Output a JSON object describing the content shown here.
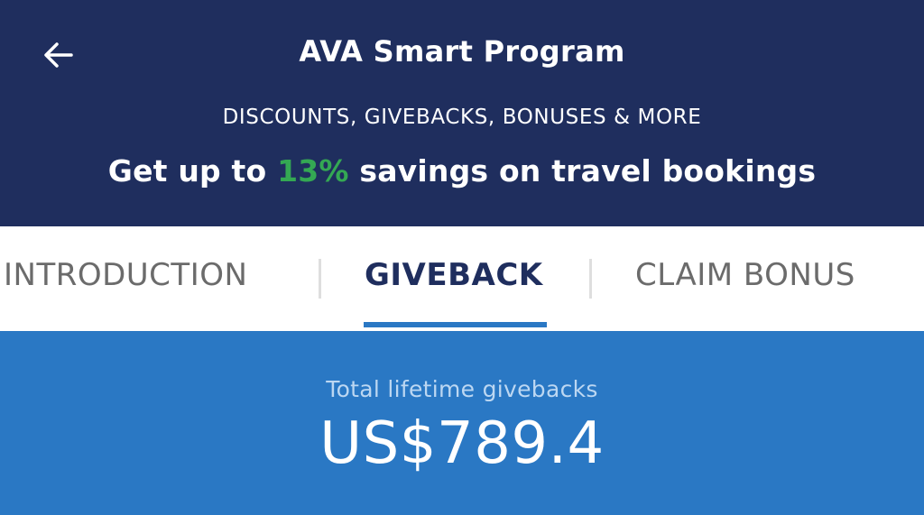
{
  "header": {
    "back_icon": "arrow-left-icon",
    "title": "AVA Smart Program",
    "subtitle": "DISCOUNTS, GIVEBACKS, BONUSES & MORE",
    "promo": {
      "prefix": "Get up to ",
      "percent": "13%",
      "suffix": " savings on travel bookings"
    }
  },
  "tabs": [
    {
      "label": "INTRODUCTION",
      "active": false
    },
    {
      "label": "GIVEBACK",
      "active": true
    },
    {
      "label": "CLAIM BONUS",
      "active": false
    }
  ],
  "stats": {
    "label": "Total lifetime givebacks",
    "value": "US$789.4"
  },
  "colors": {
    "header_bg": "#1f2e5e",
    "accent_blue": "#2a78c4",
    "promo_green": "#34a853"
  }
}
